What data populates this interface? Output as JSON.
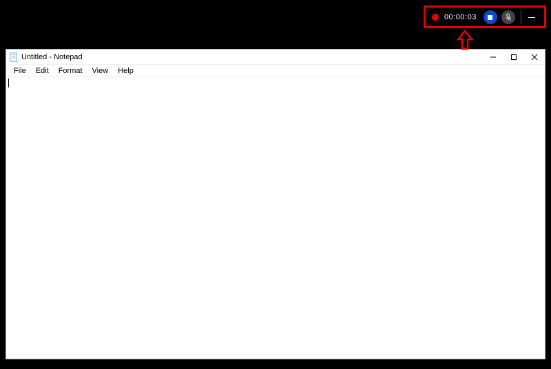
{
  "recording": {
    "timer": "00:00:03"
  },
  "notepad": {
    "title": "Untitled - Notepad",
    "menu": {
      "file": "File",
      "edit": "Edit",
      "format": "Format",
      "view": "View",
      "help": "Help"
    },
    "content": ""
  }
}
